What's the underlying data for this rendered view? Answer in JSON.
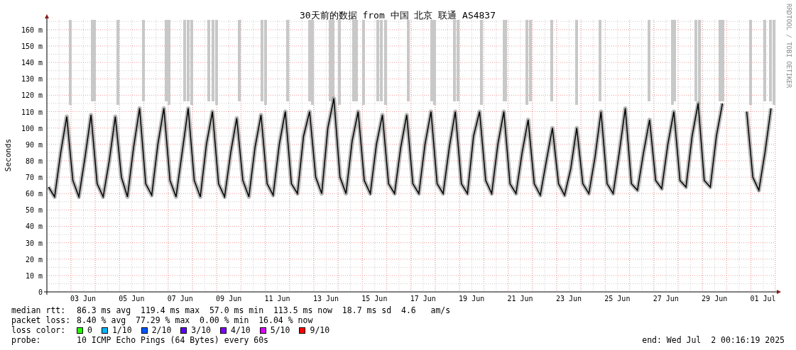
{
  "title": "30天前的数据 from 中国 北京 联通 AS4837",
  "side_label": "RRDTOOL / TOBI OETIKER",
  "chart_data": {
    "type": "line",
    "ylabel": "Seconds",
    "ylim": [
      0,
      166
    ],
    "grid": true,
    "yticks": [
      {
        "value": 0,
        "label": "0"
      },
      {
        "value": 10,
        "label": "10 m"
      },
      {
        "value": 20,
        "label": "20 m"
      },
      {
        "value": 30,
        "label": "30 m"
      },
      {
        "value": 40,
        "label": "40 m"
      },
      {
        "value": 50,
        "label": "50 m"
      },
      {
        "value": 60,
        "label": "60 m"
      },
      {
        "value": 70,
        "label": "70 m"
      },
      {
        "value": 80,
        "label": "80 m"
      },
      {
        "value": 90,
        "label": "90 m"
      },
      {
        "value": 100,
        "label": "100 m"
      },
      {
        "value": 110,
        "label": "110 m"
      },
      {
        "value": 120,
        "label": "120 m"
      },
      {
        "value": 130,
        "label": "130 m"
      },
      {
        "value": 140,
        "label": "140 m"
      },
      {
        "value": 150,
        "label": "150 m"
      },
      {
        "value": 160,
        "label": "160 m"
      }
    ],
    "categories": [
      null,
      null,
      null,
      null,
      null,
      null,
      "03 Jun",
      null,
      null,
      null,
      null,
      null,
      null,
      null,
      "05 Jun",
      null,
      null,
      null,
      null,
      null,
      null,
      null,
      "07 Jun",
      null,
      null,
      null,
      null,
      null,
      null,
      null,
      "09 Jun",
      null,
      null,
      null,
      null,
      null,
      null,
      null,
      "11 Jun",
      null,
      null,
      null,
      null,
      null,
      null,
      null,
      "13 Jun",
      null,
      null,
      null,
      null,
      null,
      null,
      null,
      "15 Jun",
      null,
      null,
      null,
      null,
      null,
      null,
      null,
      "17 Jun",
      null,
      null,
      null,
      null,
      null,
      null,
      null,
      "19 Jun",
      null,
      null,
      null,
      null,
      null,
      null,
      null,
      "21 Jun",
      null,
      null,
      null,
      null,
      null,
      null,
      null,
      "23 Jun",
      null,
      null,
      null,
      null,
      null,
      null,
      null,
      "25 Jun",
      null,
      null,
      null,
      null,
      null,
      null,
      null,
      "27 Jun",
      null,
      null,
      null,
      null,
      null,
      null,
      null,
      "29 Jun",
      null,
      null,
      null,
      null,
      null,
      null,
      null,
      "01 Jul",
      null
    ],
    "series": [
      {
        "color": "#000000",
        "values": [
          64,
          58,
          85,
          107,
          68,
          58,
          82,
          108,
          66,
          58,
          80,
          107,
          70,
          58,
          88,
          112,
          66,
          59,
          90,
          112,
          68,
          58,
          85,
          112,
          68,
          58,
          90,
          110,
          66,
          58,
          85,
          106,
          68,
          58,
          88,
          108,
          66,
          59,
          90,
          110,
          66,
          60,
          95,
          110,
          70,
          60,
          100,
          118,
          70,
          60,
          92,
          110,
          68,
          60,
          90,
          108,
          66,
          60,
          88,
          108,
          66,
          60,
          90,
          110,
          66,
          60,
          88,
          110,
          66,
          60,
          95,
          110,
          68,
          60,
          90,
          110,
          66,
          60,
          85,
          105,
          66,
          59,
          80,
          100,
          66,
          59,
          75,
          100,
          66,
          60,
          82,
          110,
          66,
          60,
          85,
          112,
          66,
          62,
          85,
          105,
          68,
          63,
          90,
          110,
          68,
          64,
          95,
          115,
          68,
          64,
          95,
          115,
          null,
          null,
          null,
          110,
          70,
          62,
          85,
          112
        ]
      }
    ]
  },
  "stats": [
    {
      "label": "median rtt:",
      "text": "86.3 ms avg  119.4 ms max  57.0 ms min  113.5 ms now  18.7 ms sd  4.6   am/s"
    },
    {
      "label": "packet loss:",
      "text": "8.40 % avg  77.29 % max  0.00 % min  16.04 % now"
    }
  ],
  "loss_color": {
    "label": "loss color:",
    "items": [
      {
        "label": "0",
        "color": "#26ff00"
      },
      {
        "label": "1/10",
        "color": "#00b8ff"
      },
      {
        "label": "2/10",
        "color": "#0059ff"
      },
      {
        "label": "3/10",
        "color": "#5e00ff"
      },
      {
        "label": "4/10",
        "color": "#7e00ff"
      },
      {
        "label": "5/10",
        "color": "#dd00ff"
      },
      {
        "label": "9/10",
        "color": "#ff0000"
      }
    ]
  },
  "probe": {
    "label": "probe:",
    "text": "10 ICMP Echo Pings (64 Bytes) every 60s"
  },
  "end": "end: Wed Jul  2 00:16:19 2025"
}
